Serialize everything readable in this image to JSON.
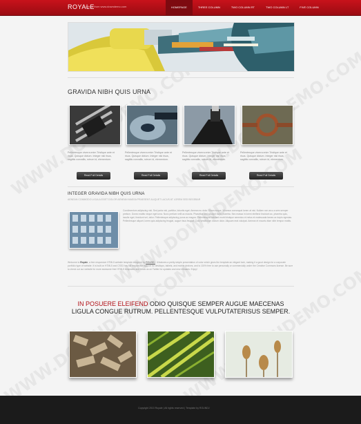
{
  "header": {
    "logo": "ROYALE",
    "tagline": "collect from www.downdemo.com",
    "nav": [
      "HOMEPAGE",
      "THREE COLUMN",
      "TWO COLUMN RT",
      "TWO COLUMN LT",
      "FIVE COLUMN"
    ]
  },
  "section1": {
    "title": "GRAVIDA NIBH QUIS URNA"
  },
  "features": [
    {
      "text": "Pellentesque viverra enim Tristique ante et risus. Quisque dictum. Integer nisl risus, sagittis convallis, rutrum id, elementum.",
      "button": "Read Full Details"
    },
    {
      "text": "Pellentesque viverra enim Tristique ante et risus. Quisque dictum. Integer nisl risus, sagittis convallis, rutrum id, elementum.",
      "button": "Read Full Details"
    },
    {
      "text": "Pellentesque viverra enim Tristique ante et risus. Quisque dictum. Integer nisl risus, sagittis convallis, rutrum id, elementum.",
      "button": "Read Full Details"
    },
    {
      "text": "Pellentesque viverra enim Tristique ante et risus. Quisque dictum. Integer nisl risus, sagittis convallis, rutrum id, elementum.",
      "button": "Read Full Details"
    }
  ],
  "section2": {
    "title": "INTEGER GRAVIDA NIBH QUIS URNA",
    "subtitle": "AENEAN COMMODO LIGULA EGET DOLOR AENEAN MASSA PRAESENT ALIQUET LACUS AT LOREM SED BEGEBAR",
    "body": "Condimentum adipiscing nisl. Sed porta nisl, porttitor, lobortis eget. Aenean eu dolor. Etiam neque. Vivamus consequat lorem at nisi. Nullam non arcu a sem semper pretium. Donec mattis neque eget urna. Nunc pretium velit ac mauris. Phasellus sed suscipit nulla pharetra. Nec massa in lorem eleifend tincidunt ac, pharetra quis, iaculis eget, tincidunt vel, dolor. Pellentesque adipiscing purus ac magna. Pellentesque habitant morbi tristique senectus et netus et malesuada fames ac turpis egestas. Pellentesque aliquet, lorem quis adipiscing feugiat, augue risus feugiat. Cras vestibulum dictum dolor. Aliquam erat volutpat. Aenean et mauris vitae nibh tempor mattis.",
    "intro_prefix": "Welcome to ",
    "brand": "Royale",
    "intro_mid": ", a free responsive HTML5 website template designed by ",
    "designer": "ROUNDJ",
    "intro_suffix": ". It features a pretty simple presentation of color which gives the template an elegant look, making it a good design for a corporate portfolio type of website. It is built on HTML5 and CSS3 has full responsive support for desktops, tablets, and mobile devices, and is 100% free to use personally or commercially under the Creative Commons license. Be sure to check out our website for more awesome free HTML5 templates and follow us on Twitter for updates and new releases. Enjoy!"
  },
  "quote": {
    "highlight": "IN POSUERE ELEIFEND",
    "rest": " ODIO QUISQUE SEMPER AUGUE MAECENAS LIGULA CONGUE RUTRUM. PELLENTESQUE VULPUTATERISUS SEMPER."
  },
  "footer": {
    "text": "Copyright 2013 Royale | All rights reserved | Template by ROUNDJ"
  },
  "watermark": "WWW.DOWNDEMO.COM"
}
